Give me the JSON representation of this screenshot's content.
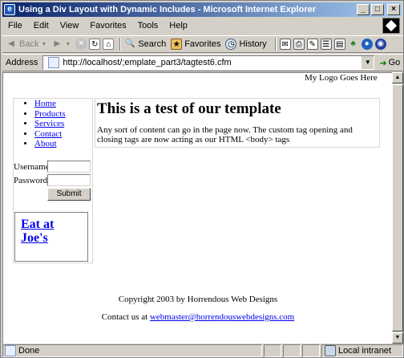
{
  "window": {
    "title": "Using a Div Layout with Dynamic Includes - Microsoft Internet Explorer",
    "minimize_glyph": "_",
    "maximize_glyph": "□",
    "close_glyph": "×"
  },
  "menubar": {
    "items": [
      "File",
      "Edit",
      "View",
      "Favorites",
      "Tools",
      "Help"
    ]
  },
  "toolbar": {
    "back_label": "Back",
    "search_label": "Search",
    "favorites_label": "Favorites",
    "history_label": "History"
  },
  "address": {
    "label": "Address",
    "url": "http://localhost/;emplate_part3/tagtest6.cfm",
    "go_label": "Go"
  },
  "page": {
    "logo_text": "My Logo Goes Here",
    "nav": [
      "Home",
      "Products",
      "Services",
      "Contact",
      "About"
    ],
    "login": {
      "username_label": "Username",
      "password_label": "Password",
      "submit_label": "Submit"
    },
    "ad_line1": "Eat at",
    "ad_line2": "Joe's",
    "heading": "This is a test of our template",
    "body_text": "Any sort of content can go in the page now. The custom tag opening and closing tags are now acting as our HTML <body> tags",
    "footer_copyright": "Copyright 2003 by Horrendous Web Designs",
    "footer_contact_prefix": "Contact us at ",
    "footer_email": "webmaster@horrendouswebdesigns.com"
  },
  "statusbar": {
    "status": "Done",
    "zone": "Local intranet"
  },
  "colors": {
    "titlebar_start": "#0a246a",
    "titlebar_end": "#a6caf0",
    "link": "#0000ee",
    "chrome": "#d4d0c8"
  }
}
